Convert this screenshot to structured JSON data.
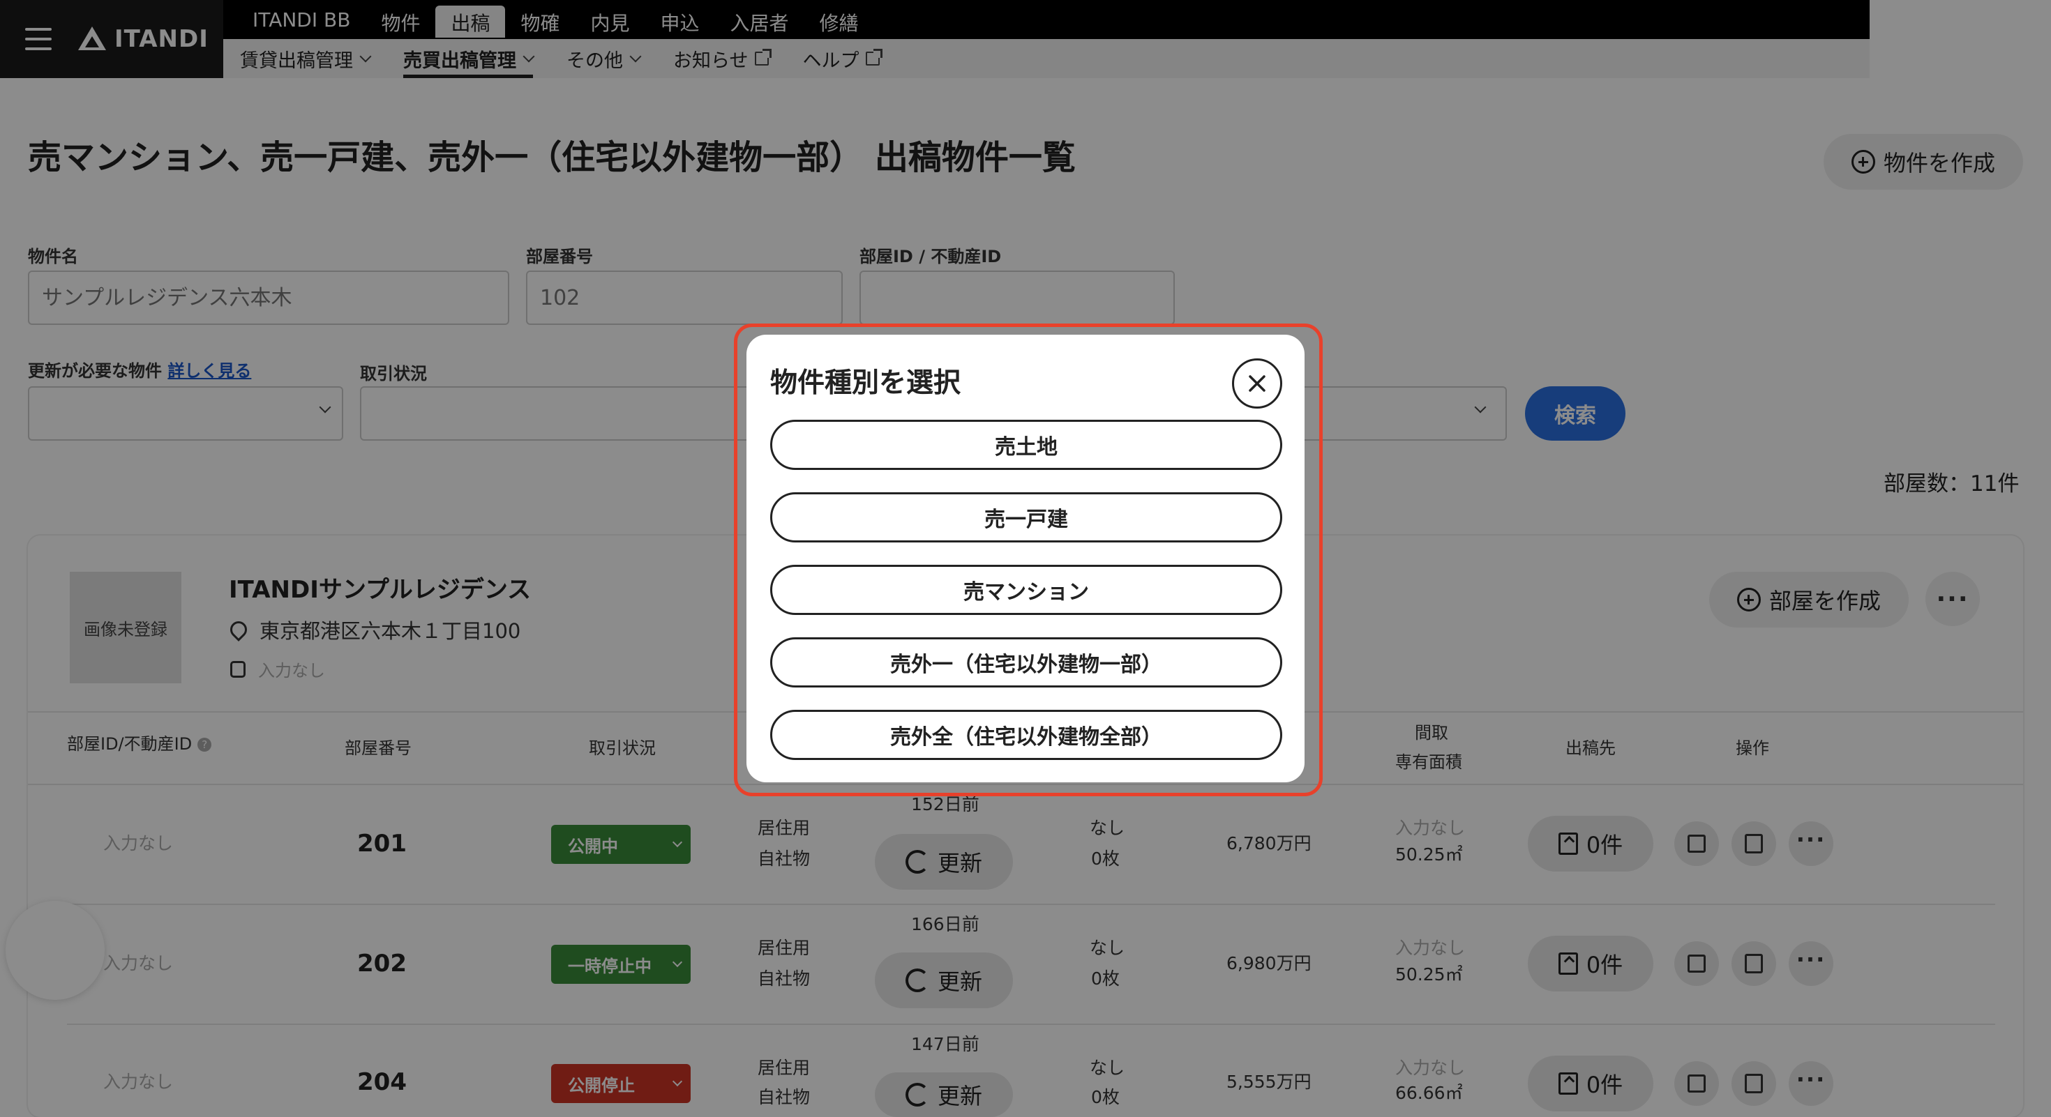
{
  "header": {
    "logo_text": "ITANDI",
    "main_tabs": [
      "ITANDI BB",
      "物件",
      "出稿",
      "物確",
      "内見",
      "申込",
      "入居者",
      "修繕"
    ],
    "active_tab": "出稿",
    "sub_nav": [
      {
        "label": "賃貸出稿管理",
        "kind": "dropdown"
      },
      {
        "label": "売買出稿管理",
        "kind": "dropdown"
      },
      {
        "label": "その他",
        "kind": "dropdown"
      },
      {
        "label": "お知らせ",
        "kind": "external"
      },
      {
        "label": "ヘルプ",
        "kind": "external"
      }
    ]
  },
  "page": {
    "title": "売マンション、売一戸建、売外一（住宅以外建物一部） 出稿物件一覧",
    "create_property_label": "物件を作成"
  },
  "filters": {
    "property_name_label": "物件名",
    "property_name_placeholder": "サンプルレジデンス六本木",
    "room_number_label": "部屋番号",
    "room_number_placeholder": "102",
    "room_id_label": "部屋ID / 不動産ID",
    "needs_update_label": "更新が必要な物件",
    "details_link": "詳しく見る",
    "deal_status_label": "取引状況",
    "search_label": "検索"
  },
  "room_count": "部屋数：11件",
  "property": {
    "no_image": "画像未登録",
    "name": "ITANDIサンプルレジデンス",
    "address": "東京都港区六本木１丁目100",
    "station": "入力なし",
    "create_room_label": "部屋を作成"
  },
  "table": {
    "headers": {
      "id": "部屋ID/不動産ID",
      "room": "部屋番号",
      "status": "取引状況",
      "layout_line1": "間取",
      "layout_line2": "専有面積",
      "posted_to": "出稿先",
      "actions": "操作"
    },
    "rows": [
      {
        "id": "入力なし",
        "room": "201",
        "status": "公開中",
        "status_color": "#3a8a3a",
        "use1": "居住用",
        "use2": "自社物",
        "days": "152日前",
        "renew": "更新",
        "x1": "なし",
        "x2": "0枚",
        "price": "6,780万円",
        "layout": "入力なし",
        "area": "50.25㎡",
        "posted": "0件"
      },
      {
        "id": "入力なし",
        "room": "202",
        "status": "一時停止中",
        "status_color": "#3a8a3a",
        "use1": "居住用",
        "use2": "自社物",
        "days": "166日前",
        "renew": "更新",
        "x1": "なし",
        "x2": "0枚",
        "price": "6,980万円",
        "layout": "入力なし",
        "area": "50.25㎡",
        "posted": "0件"
      },
      {
        "id": "入力なし",
        "room": "204",
        "status": "公開停止",
        "status_color": "#cc3326",
        "use1": "居住用",
        "use2": "自社物",
        "days": "147日前",
        "renew": "更新",
        "x1": "なし",
        "x2": "0枚",
        "price": "5,555万円",
        "layout": "入力なし",
        "area": "66.66㎡",
        "posted": "0件"
      }
    ]
  },
  "modal": {
    "title": "物件種別を選択",
    "options": [
      "売土地",
      "売一戸建",
      "売マンション",
      "売外一（住宅以外建物一部）",
      "売外全（住宅以外建物全部）"
    ]
  },
  "colors": {
    "accent": "#2a6fe0",
    "highlight_ring": "#e8412b",
    "status_green": "#3a8a3a",
    "status_red": "#cc3326"
  }
}
